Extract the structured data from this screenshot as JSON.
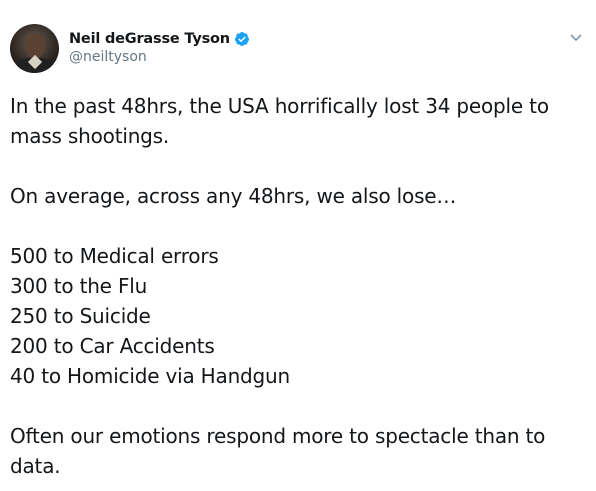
{
  "user": {
    "display_name": "Neil deGrasse Tyson",
    "handle": "@neiltyson",
    "verified": true
  },
  "icons": {
    "verified": "verified-badge-icon",
    "caret": "chevron-down-icon"
  },
  "colors": {
    "verified_blue": "#1da1f2",
    "text": "#14171a",
    "secondary": "#657786"
  },
  "tweet": {
    "paragraph1": {
      "line1": "In the past 48hrs, the USA horrifically lost 34 people to",
      "line2": "mass shootings."
    },
    "paragraph2": "On average, across any 48hrs, we also lose…",
    "stats": [
      "500 to Medical errors",
      "300 to the Flu",
      "250 to Suicide",
      "200 to Car Accidents",
      "40 to Homicide via Handgun"
    ],
    "paragraph4": {
      "line1": "Often our emotions respond more to spectacle than to",
      "line2": "data."
    }
  }
}
